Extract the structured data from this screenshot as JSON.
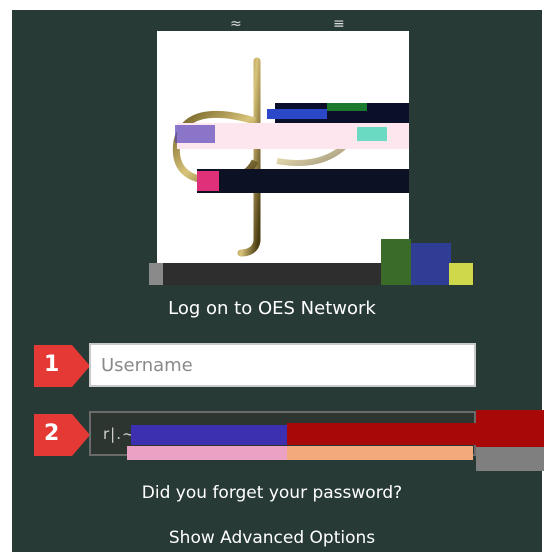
{
  "title": "Log on to OES Network",
  "username": {
    "placeholder": "Username",
    "value": ""
  },
  "password": {
    "masked_value": "r|.~"
  },
  "badges": {
    "first": "1",
    "second": "2"
  },
  "links": {
    "forgot": "Did you forget your password?",
    "advanced": "Show Advanced Options"
  },
  "colors": {
    "background": "#283a36",
    "badge": "#e53935",
    "text": "#ffffff"
  }
}
